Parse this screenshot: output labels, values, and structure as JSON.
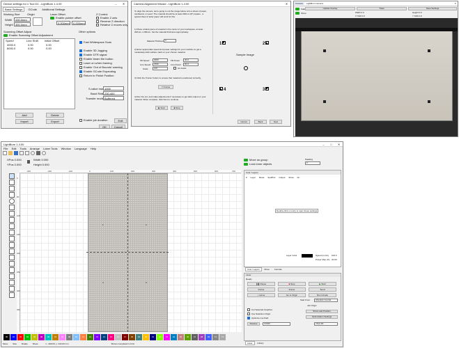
{
  "device_settings": {
    "title": "Device settings for x Tool D1 - LightBurn 1.4.00",
    "tabs": [
      "Basic Settings",
      "GCode",
      "Additional Settings"
    ],
    "working_size_label": "Working Size",
    "origin_label": "Origin",
    "width_label": "Width",
    "width_value": "430.0mm",
    "height_label": "Height",
    "height_value": "390.0mm",
    "laser_offset_label": "Laser Offset",
    "enable_pointer_offset": "Enable pointer offset",
    "x_offset": "0.000mm",
    "y_offset": "0.000mm",
    "zcontrol_label": "Z Control",
    "enable_z_axis": "Enable Z axis",
    "reverse_z": "Reverse Z direction",
    "relative_z": "Relative Z moves only",
    "scan_offset_title": "Scanning Offset Adjust",
    "enable_scan_offset": "Enable Scanning Offset Adjustment",
    "scan_columns": [
      "Speed",
      "Line Shift",
      "Initial Offset"
    ],
    "scan_rows": [
      [
        "3000.0",
        "0.00",
        "0.00"
      ],
      [
        "6000.0",
        "0.00",
        "0.00"
      ]
    ],
    "other_options_label": "Other options",
    "fast_whitespace": "Fast Whitespace Scan",
    "options": [
      "Enable 3D Jogging",
      "Enable DTR signal",
      "Enable beam fire button",
      "Laser on when framing",
      "Enable 'Out of Bounds' warning",
      "Enable GCode Expanding",
      "Return to Finish Position"
    ],
    "sbaud_label": "S-value max",
    "sbaud_value": "1000",
    "baud_label": "Baud Rate",
    "baud_value": "230,400",
    "transfer_label": "Transfer mode",
    "transfer_value": "Buffered",
    "enable_job_duration": "Enable job duration",
    "add": "Add",
    "delete": "Delete",
    "import": "Import",
    "export": "Export",
    "edit": "Edit",
    "ok": "OK",
    "cancel": "Cancel"
  },
  "wizard": {
    "title": "Camera Alignment Wizard - LightBurn 1.4.00",
    "intro": "To align the camera, we're going to cut the image below onto a sheet of paper, cardboard, or wood. The material should be at least 200mm (8\") square - a typical sheet of letter paper will work for this.",
    "step1": "1) Place a blank piece of material in the center of your workspace, at least 200mm x 200mm. Set the material thickness appropriately.",
    "material_label": "Material Thickness",
    "material_value": "0",
    "step2": "2) Enter appropriate speed and power settings for your machine to get a moderately dark surface mark on your chosen material.",
    "fill_speed": "Fill Speed",
    "fill_speed_v": "3000",
    "fill_power": "Fill Power",
    "fill_power_v": "40.0",
    "line_speed": "Line Speed",
    "line_speed_v": "1500",
    "line_power": "Line Power",
    "line_power_v": "60.0",
    "scale": "Scale",
    "scale_v": "100",
    "air_assist": "Air Assist",
    "step3": "3) Click the 'Frame' button to ensure that material is positioned correctly.",
    "frame": "Frame",
    "step4": "4) Run the cut, and make adjustments if necessary to get dark output on your material. When complete, click Next to continue.",
    "start": "Start",
    "stop": "Stop",
    "sample_label": "Sample Image",
    "markers": [
      "1",
      "2",
      "3",
      "4"
    ],
    "cancel": "Cancel",
    "back": "Back",
    "next": "Next"
  },
  "camera": {
    "title": "LightBurn Camera",
    "tab": "Camera",
    "fade": "Fade",
    "show": "Show",
    "update_overlay": "Update Overlay",
    "trace": "Trace",
    "save_settings": "Save Settings",
    "width": "Width 0.0",
    "height": "Height 0.0",
    "xshift": "X Shift 0.0",
    "yshift": "Y Shift 0.0"
  },
  "main": {
    "title": "LightBurn 1.4.00",
    "menus": [
      "File",
      "Edit",
      "Tools",
      "Arrange",
      "Laser Tools",
      "Window",
      "Language",
      "Help"
    ],
    "xpos": "XPos 0.000",
    "ypos": "YPos 0.000",
    "width": "Width 0.000",
    "height": "Height 0.000",
    "ruler_h": [
      "-300",
      "-200",
      "-100",
      "0",
      "100",
      "200",
      "300",
      "400",
      "500",
      "600",
      "700"
    ],
    "ruler_v": [
      "0",
      "50",
      "100",
      "150",
      "200",
      "250",
      "300",
      "350"
    ],
    "bed_marks": [
      "1",
      "2",
      "3",
      "4"
    ],
    "status": "x: -469.00, y: 444.00 mm",
    "shown_completed": "Shown completed in 9.0s",
    "move": "Move",
    "size": "Size",
    "rotate": "Rotate",
    "shear": "Shear",
    "palette": [
      "00",
      "01",
      "02",
      "03",
      "04",
      "05",
      "06",
      "07",
      "08",
      "09",
      "10",
      "11",
      "12",
      "13",
      "14",
      "15",
      "16",
      "17",
      "18",
      "19",
      "20",
      "21",
      "22",
      "23",
      "24",
      "25",
      "26",
      "27",
      "28",
      "29",
      "T1",
      "T2"
    ],
    "palette_colors": [
      "#000000",
      "#0000ff",
      "#ff0000",
      "#00c000",
      "#c0c000",
      "#c000c0",
      "#00c0c0",
      "#c08000",
      "#ff80ff",
      "#808080",
      "#80c0ff",
      "#ff8040",
      "#408000",
      "#8000ff",
      "#004080",
      "#ff0080",
      "#c0c0c0",
      "#800000",
      "#804000",
      "#408080",
      "#ffc000",
      "#000080",
      "#80ff00",
      "#ff00ff",
      "#0080c0",
      "#c08080",
      "#60a000",
      "#606060",
      "#a040c0",
      "#4060ff",
      "#888888",
      "#aaaaaa"
    ],
    "cuts_title": "Cuts / Layers",
    "cuts_columns": [
      "#",
      "Layer",
      "Mode",
      "Spd/Pwr",
      "Output",
      "Show",
      "Air"
    ],
    "cuts_hint": "Double-click on entry to open these settings",
    "move_group": "Move as group",
    "lock_aspect": "Lock inner objects",
    "padding": "Padding",
    "padding_v": "0",
    "layer_color": "Layer Color",
    "speed_label": "Speed (mm/s)",
    "speed_v": "100.0",
    "power_label": "Power Max (%)",
    "power_v": "20.00",
    "panel_tabs": [
      "Cuts / Layers",
      "Move",
      "Console"
    ],
    "laser_title": "Laser",
    "ready": "Ready",
    "pause": "Pause",
    "stop": "Stop",
    "start": "Start",
    "frame": "Frame",
    "frame2": "Frame",
    "send": "Send",
    "home": "Home",
    "goto_origin": "Go to Origin",
    "run_gcode": "Run GCode",
    "start_from": "Start From:",
    "start_from_v": "Absolute Coords",
    "job_origin": "Job Origin",
    "cut_selected": "Cut Selected Graphics",
    "use_selection_origin": "Use Selection Origin",
    "optimize": "Optimize Cut Path",
    "show_last_position": "Show Last Position",
    "optimization_settings": "Optimization Settings",
    "devices": "Devices",
    "port": "COM3",
    "device_name": "xTool D1",
    "bottom_tabs": [
      "Laser",
      "Library"
    ]
  }
}
